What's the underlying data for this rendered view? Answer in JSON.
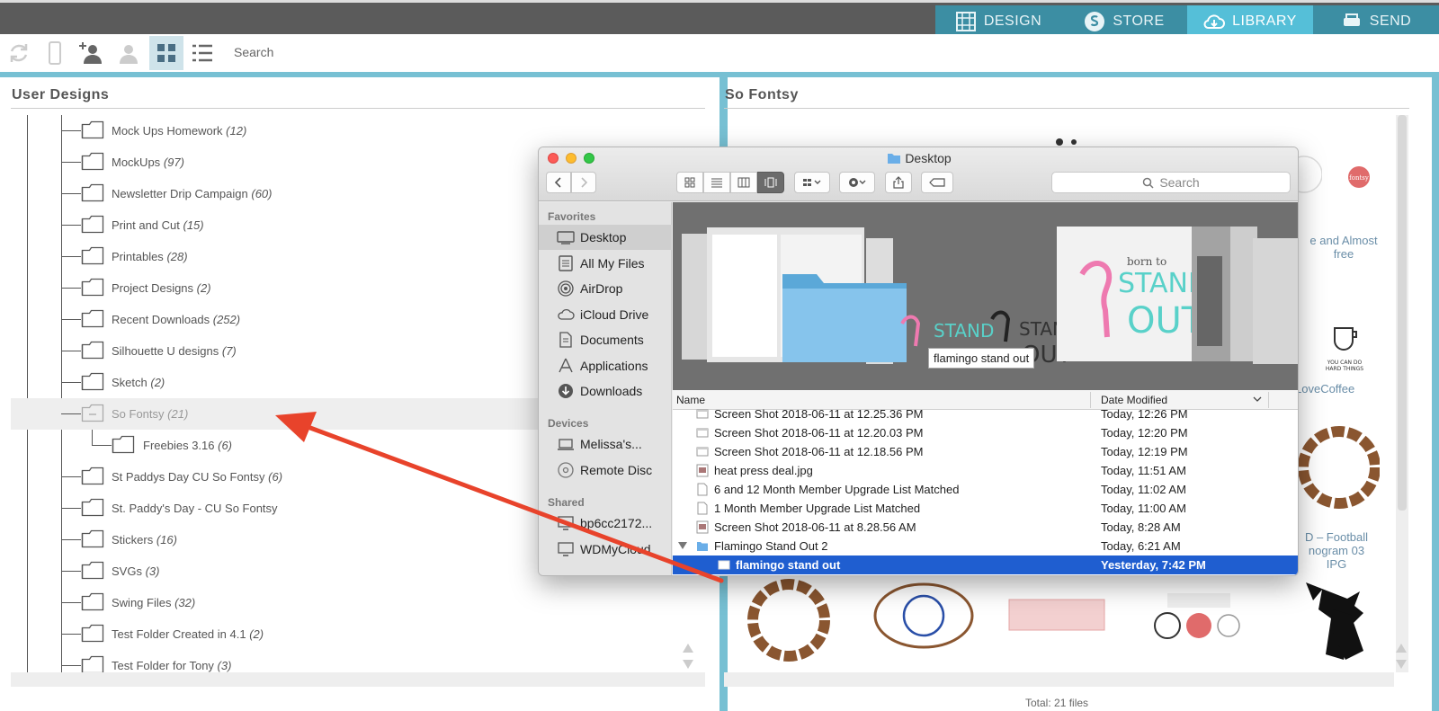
{
  "nav": {
    "tabs": [
      {
        "label": "DESIGN",
        "icon": "grid-icon"
      },
      {
        "label": "STORE",
        "icon": "store-s-icon"
      },
      {
        "label": "LIBRARY",
        "icon": "cloud-download-icon",
        "active": true
      },
      {
        "label": "SEND",
        "icon": "cutter-icon"
      }
    ]
  },
  "toolbar": {
    "search_placeholder": "Search"
  },
  "left_panel": {
    "title": "User Designs",
    "items": [
      {
        "name": "Mock Ups Homework",
        "count": "(12)"
      },
      {
        "name": "MockUps",
        "count": "(97)"
      },
      {
        "name": "Newsletter Drip Campaign",
        "count": "(60)"
      },
      {
        "name": "Print and Cut",
        "count": "(15)"
      },
      {
        "name": "Printables",
        "count": "(28)"
      },
      {
        "name": "Project Designs",
        "count": "(2)"
      },
      {
        "name": "Recent Downloads",
        "count": "(252)"
      },
      {
        "name": "Silhouette U designs",
        "count": "(7)"
      },
      {
        "name": "Sketch",
        "count": "(2)"
      },
      {
        "name": "So Fontsy",
        "count": "(21)"
      },
      {
        "name": "Freebies 3.16",
        "count": "(6)"
      },
      {
        "name": "St Paddys Day CU So Fontsy",
        "count": "(6)"
      },
      {
        "name": "St. Paddy's Day - CU So Fontsy",
        "count": ""
      },
      {
        "name": "Stickers",
        "count": "(16)"
      },
      {
        "name": "SVGs",
        "count": "(3)"
      },
      {
        "name": "Swing Files",
        "count": "(32)"
      },
      {
        "name": "Test Folder Created in 4.1 ",
        "count": "(2)"
      },
      {
        "name": "Test Folder for Tony",
        "count": "(3)"
      }
    ]
  },
  "right_panel": {
    "title": "So Fontsy",
    "captions": [
      "e and Almost",
      "free",
      "LoveCoffee",
      "D – Football",
      "nogram 03",
      "IPG"
    ],
    "total_files": "Total: 21 files"
  },
  "finder": {
    "title": "Desktop",
    "search_placeholder": "Search",
    "sidebar": {
      "favorites_label": "Favorites",
      "favorites": [
        "Desktop",
        "All My Files",
        "AirDrop",
        "iCloud Drive",
        "Documents",
        "Applications",
        "Downloads"
      ],
      "devices_label": "Devices",
      "devices": [
        "Melissa's...",
        "Remote Disc"
      ],
      "shared_label": "Shared",
      "shared": [
        "bp6cc2172...",
        "WDMyCloud"
      ]
    },
    "tooltip": "flamingo stand out",
    "columns": {
      "name": "Name",
      "date": "Date Modified"
    },
    "files": [
      {
        "name": "Screen Shot 2018-06-11 at 12.25.36 PM",
        "date": "Today, 12:26 PM"
      },
      {
        "name": "Screen Shot 2018-06-11 at 12.20.03 PM",
        "date": "Today, 12:20 PM"
      },
      {
        "name": "Screen Shot 2018-06-11 at 12.18.56 PM",
        "date": "Today, 12:19 PM"
      },
      {
        "name": "heat press deal.jpg",
        "date": "Today, 11:51 AM"
      },
      {
        "name": "6 and 12 Month Member Upgrade List Matched",
        "date": "Today, 11:02 AM"
      },
      {
        "name": "1 Month Member Upgrade List Matched",
        "date": "Today, 11:00 AM"
      },
      {
        "name": "Screen Shot 2018-06-11 at 8.28.56 AM",
        "date": "Today, 8:28 AM"
      },
      {
        "name": "Flamingo Stand Out 2",
        "date": "Today, 6:21 AM"
      },
      {
        "name": "flamingo stand out",
        "date": "Yesterday, 7:42 PM"
      }
    ],
    "preview_text": {
      "born_to": "born to",
      "stand": "STAND",
      "out": "OUT"
    }
  },
  "colors": {
    "accent": "#55bfd8",
    "nav_bg": "#3c8ea3",
    "selection": "#1f5ed0",
    "arrow": "#e8432b"
  }
}
